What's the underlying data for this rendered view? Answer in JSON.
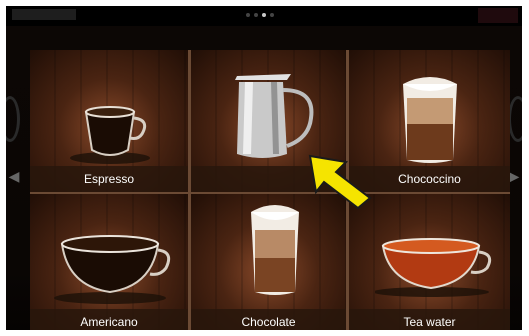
{
  "header": {
    "title": "",
    "page_indicator": {
      "current": 3,
      "total": 4
    }
  },
  "drinks": [
    {
      "label": "Espresso",
      "icon": "espresso-cup-icon"
    },
    {
      "label": "",
      "icon": "milk-pitcher-icon"
    },
    {
      "label": "Chococcino",
      "icon": "chococcino-glass-icon"
    },
    {
      "label": "Americano",
      "icon": "americano-cup-icon"
    },
    {
      "label": "Chocolate",
      "icon": "chocolate-glass-icon"
    },
    {
      "label": "Tea water",
      "icon": "tea-cup-icon"
    }
  ],
  "annotation": {
    "icon": "pointer-arrow-icon",
    "color": "#f5e400"
  },
  "colors": {
    "tile_center": "#8a4a2a",
    "tile_edge": "#200e06",
    "label_bg": "#28160c",
    "label_text": "#ffffff"
  }
}
